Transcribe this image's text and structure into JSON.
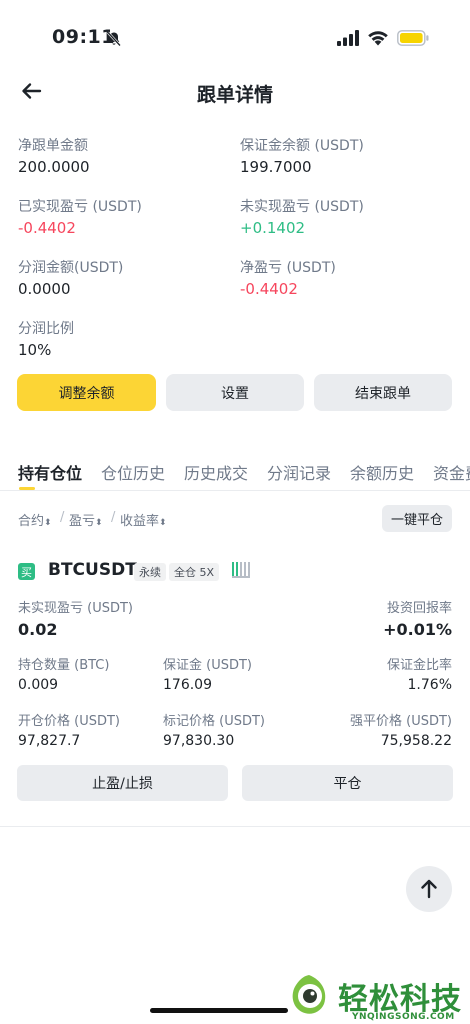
{
  "status_bar": {
    "time": "09:11"
  },
  "header": {
    "title": "跟单详情"
  },
  "stats": {
    "net_amount": {
      "label": "净跟单金额",
      "value": "200.0000"
    },
    "margin_balance": {
      "label": "保证金余额 (USDT)",
      "value": "199.7000"
    },
    "realized_pnl": {
      "label": "已实现盈亏 (USDT)",
      "value": "-0.4402"
    },
    "unrealized_pnl": {
      "label": "未实现盈亏 (USDT)",
      "value": "+0.1402"
    },
    "profit_share_amount": {
      "label": "分润金额(USDT)",
      "value": "0.0000"
    },
    "net_pnl": {
      "label": "净盈亏 (USDT)",
      "value": "-0.4402"
    },
    "profit_share_ratio": {
      "label": "分润比例",
      "value": "10%"
    }
  },
  "actions": {
    "adjust": "调整余额",
    "settings": "设置",
    "end": "结束跟单"
  },
  "tabs": [
    "持有仓位",
    "仓位历史",
    "历史成交",
    "分润记录",
    "余额历史",
    "资金费"
  ],
  "sort": {
    "contract": "合约",
    "pnl": "盈亏",
    "roi": "收益率",
    "sep": "/",
    "close_all": "一键平仓"
  },
  "position": {
    "side": "买",
    "symbol": "BTCUSDT",
    "tag_perp": "永续",
    "tag_margin": "全仓 5X",
    "unrealized_label": "未实现盈亏 (USDT)",
    "unrealized_value": "0.02",
    "roi_label": "投资回报率",
    "roi_value": "+0.01%",
    "size_label": "持仓数量 (BTC)",
    "size_value": "0.009",
    "margin_label": "保证金 (USDT)",
    "margin_value": "176.09",
    "margin_ratio_label": "保证金比率",
    "margin_ratio_value": "1.76%",
    "entry_label": "开仓价格 (USDT)",
    "entry_value": "97,827.7",
    "mark_label": "标记价格 (USDT)",
    "mark_value": "97,830.30",
    "liq_label": "强平价格 (USDT)",
    "liq_value": "75,958.22",
    "tpsl_button": "止盈/止损",
    "close_button": "平仓"
  },
  "watermark": {
    "text": "轻松科技",
    "sub": "YNQINGSONG.COM"
  },
  "colors": {
    "accent": "#fcd535",
    "positive": "#2ebd85",
    "negative": "#f6465d",
    "muted": "#707a8a"
  }
}
